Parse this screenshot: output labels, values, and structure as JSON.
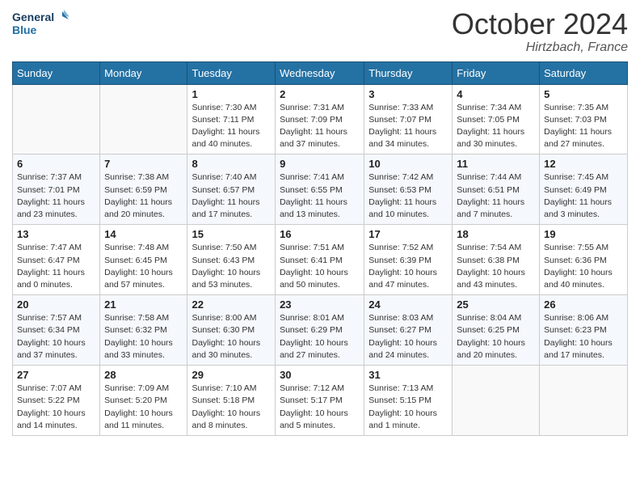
{
  "header": {
    "logo_general": "General",
    "logo_blue": "Blue",
    "month_title": "October 2024",
    "location": "Hirtzbach, France"
  },
  "days_of_week": [
    "Sunday",
    "Monday",
    "Tuesday",
    "Wednesday",
    "Thursday",
    "Friday",
    "Saturday"
  ],
  "weeks": [
    [
      {
        "day": "",
        "info": ""
      },
      {
        "day": "",
        "info": ""
      },
      {
        "day": "1",
        "sunrise": "Sunrise: 7:30 AM",
        "sunset": "Sunset: 7:11 PM",
        "daylight": "Daylight: 11 hours and 40 minutes."
      },
      {
        "day": "2",
        "sunrise": "Sunrise: 7:31 AM",
        "sunset": "Sunset: 7:09 PM",
        "daylight": "Daylight: 11 hours and 37 minutes."
      },
      {
        "day": "3",
        "sunrise": "Sunrise: 7:33 AM",
        "sunset": "Sunset: 7:07 PM",
        "daylight": "Daylight: 11 hours and 34 minutes."
      },
      {
        "day": "4",
        "sunrise": "Sunrise: 7:34 AM",
        "sunset": "Sunset: 7:05 PM",
        "daylight": "Daylight: 11 hours and 30 minutes."
      },
      {
        "day": "5",
        "sunrise": "Sunrise: 7:35 AM",
        "sunset": "Sunset: 7:03 PM",
        "daylight": "Daylight: 11 hours and 27 minutes."
      }
    ],
    [
      {
        "day": "6",
        "sunrise": "Sunrise: 7:37 AM",
        "sunset": "Sunset: 7:01 PM",
        "daylight": "Daylight: 11 hours and 23 minutes."
      },
      {
        "day": "7",
        "sunrise": "Sunrise: 7:38 AM",
        "sunset": "Sunset: 6:59 PM",
        "daylight": "Daylight: 11 hours and 20 minutes."
      },
      {
        "day": "8",
        "sunrise": "Sunrise: 7:40 AM",
        "sunset": "Sunset: 6:57 PM",
        "daylight": "Daylight: 11 hours and 17 minutes."
      },
      {
        "day": "9",
        "sunrise": "Sunrise: 7:41 AM",
        "sunset": "Sunset: 6:55 PM",
        "daylight": "Daylight: 11 hours and 13 minutes."
      },
      {
        "day": "10",
        "sunrise": "Sunrise: 7:42 AM",
        "sunset": "Sunset: 6:53 PM",
        "daylight": "Daylight: 11 hours and 10 minutes."
      },
      {
        "day": "11",
        "sunrise": "Sunrise: 7:44 AM",
        "sunset": "Sunset: 6:51 PM",
        "daylight": "Daylight: 11 hours and 7 minutes."
      },
      {
        "day": "12",
        "sunrise": "Sunrise: 7:45 AM",
        "sunset": "Sunset: 6:49 PM",
        "daylight": "Daylight: 11 hours and 3 minutes."
      }
    ],
    [
      {
        "day": "13",
        "sunrise": "Sunrise: 7:47 AM",
        "sunset": "Sunset: 6:47 PM",
        "daylight": "Daylight: 11 hours and 0 minutes."
      },
      {
        "day": "14",
        "sunrise": "Sunrise: 7:48 AM",
        "sunset": "Sunset: 6:45 PM",
        "daylight": "Daylight: 10 hours and 57 minutes."
      },
      {
        "day": "15",
        "sunrise": "Sunrise: 7:50 AM",
        "sunset": "Sunset: 6:43 PM",
        "daylight": "Daylight: 10 hours and 53 minutes."
      },
      {
        "day": "16",
        "sunrise": "Sunrise: 7:51 AM",
        "sunset": "Sunset: 6:41 PM",
        "daylight": "Daylight: 10 hours and 50 minutes."
      },
      {
        "day": "17",
        "sunrise": "Sunrise: 7:52 AM",
        "sunset": "Sunset: 6:39 PM",
        "daylight": "Daylight: 10 hours and 47 minutes."
      },
      {
        "day": "18",
        "sunrise": "Sunrise: 7:54 AM",
        "sunset": "Sunset: 6:38 PM",
        "daylight": "Daylight: 10 hours and 43 minutes."
      },
      {
        "day": "19",
        "sunrise": "Sunrise: 7:55 AM",
        "sunset": "Sunset: 6:36 PM",
        "daylight": "Daylight: 10 hours and 40 minutes."
      }
    ],
    [
      {
        "day": "20",
        "sunrise": "Sunrise: 7:57 AM",
        "sunset": "Sunset: 6:34 PM",
        "daylight": "Daylight: 10 hours and 37 minutes."
      },
      {
        "day": "21",
        "sunrise": "Sunrise: 7:58 AM",
        "sunset": "Sunset: 6:32 PM",
        "daylight": "Daylight: 10 hours and 33 minutes."
      },
      {
        "day": "22",
        "sunrise": "Sunrise: 8:00 AM",
        "sunset": "Sunset: 6:30 PM",
        "daylight": "Daylight: 10 hours and 30 minutes."
      },
      {
        "day": "23",
        "sunrise": "Sunrise: 8:01 AM",
        "sunset": "Sunset: 6:29 PM",
        "daylight": "Daylight: 10 hours and 27 minutes."
      },
      {
        "day": "24",
        "sunrise": "Sunrise: 8:03 AM",
        "sunset": "Sunset: 6:27 PM",
        "daylight": "Daylight: 10 hours and 24 minutes."
      },
      {
        "day": "25",
        "sunrise": "Sunrise: 8:04 AM",
        "sunset": "Sunset: 6:25 PM",
        "daylight": "Daylight: 10 hours and 20 minutes."
      },
      {
        "day": "26",
        "sunrise": "Sunrise: 8:06 AM",
        "sunset": "Sunset: 6:23 PM",
        "daylight": "Daylight: 10 hours and 17 minutes."
      }
    ],
    [
      {
        "day": "27",
        "sunrise": "Sunrise: 7:07 AM",
        "sunset": "Sunset: 5:22 PM",
        "daylight": "Daylight: 10 hours and 14 minutes."
      },
      {
        "day": "28",
        "sunrise": "Sunrise: 7:09 AM",
        "sunset": "Sunset: 5:20 PM",
        "daylight": "Daylight: 10 hours and 11 minutes."
      },
      {
        "day": "29",
        "sunrise": "Sunrise: 7:10 AM",
        "sunset": "Sunset: 5:18 PM",
        "daylight": "Daylight: 10 hours and 8 minutes."
      },
      {
        "day": "30",
        "sunrise": "Sunrise: 7:12 AM",
        "sunset": "Sunset: 5:17 PM",
        "daylight": "Daylight: 10 hours and 5 minutes."
      },
      {
        "day": "31",
        "sunrise": "Sunrise: 7:13 AM",
        "sunset": "Sunset: 5:15 PM",
        "daylight": "Daylight: 10 hours and 1 minute."
      },
      {
        "day": "",
        "info": ""
      },
      {
        "day": "",
        "info": ""
      }
    ]
  ]
}
